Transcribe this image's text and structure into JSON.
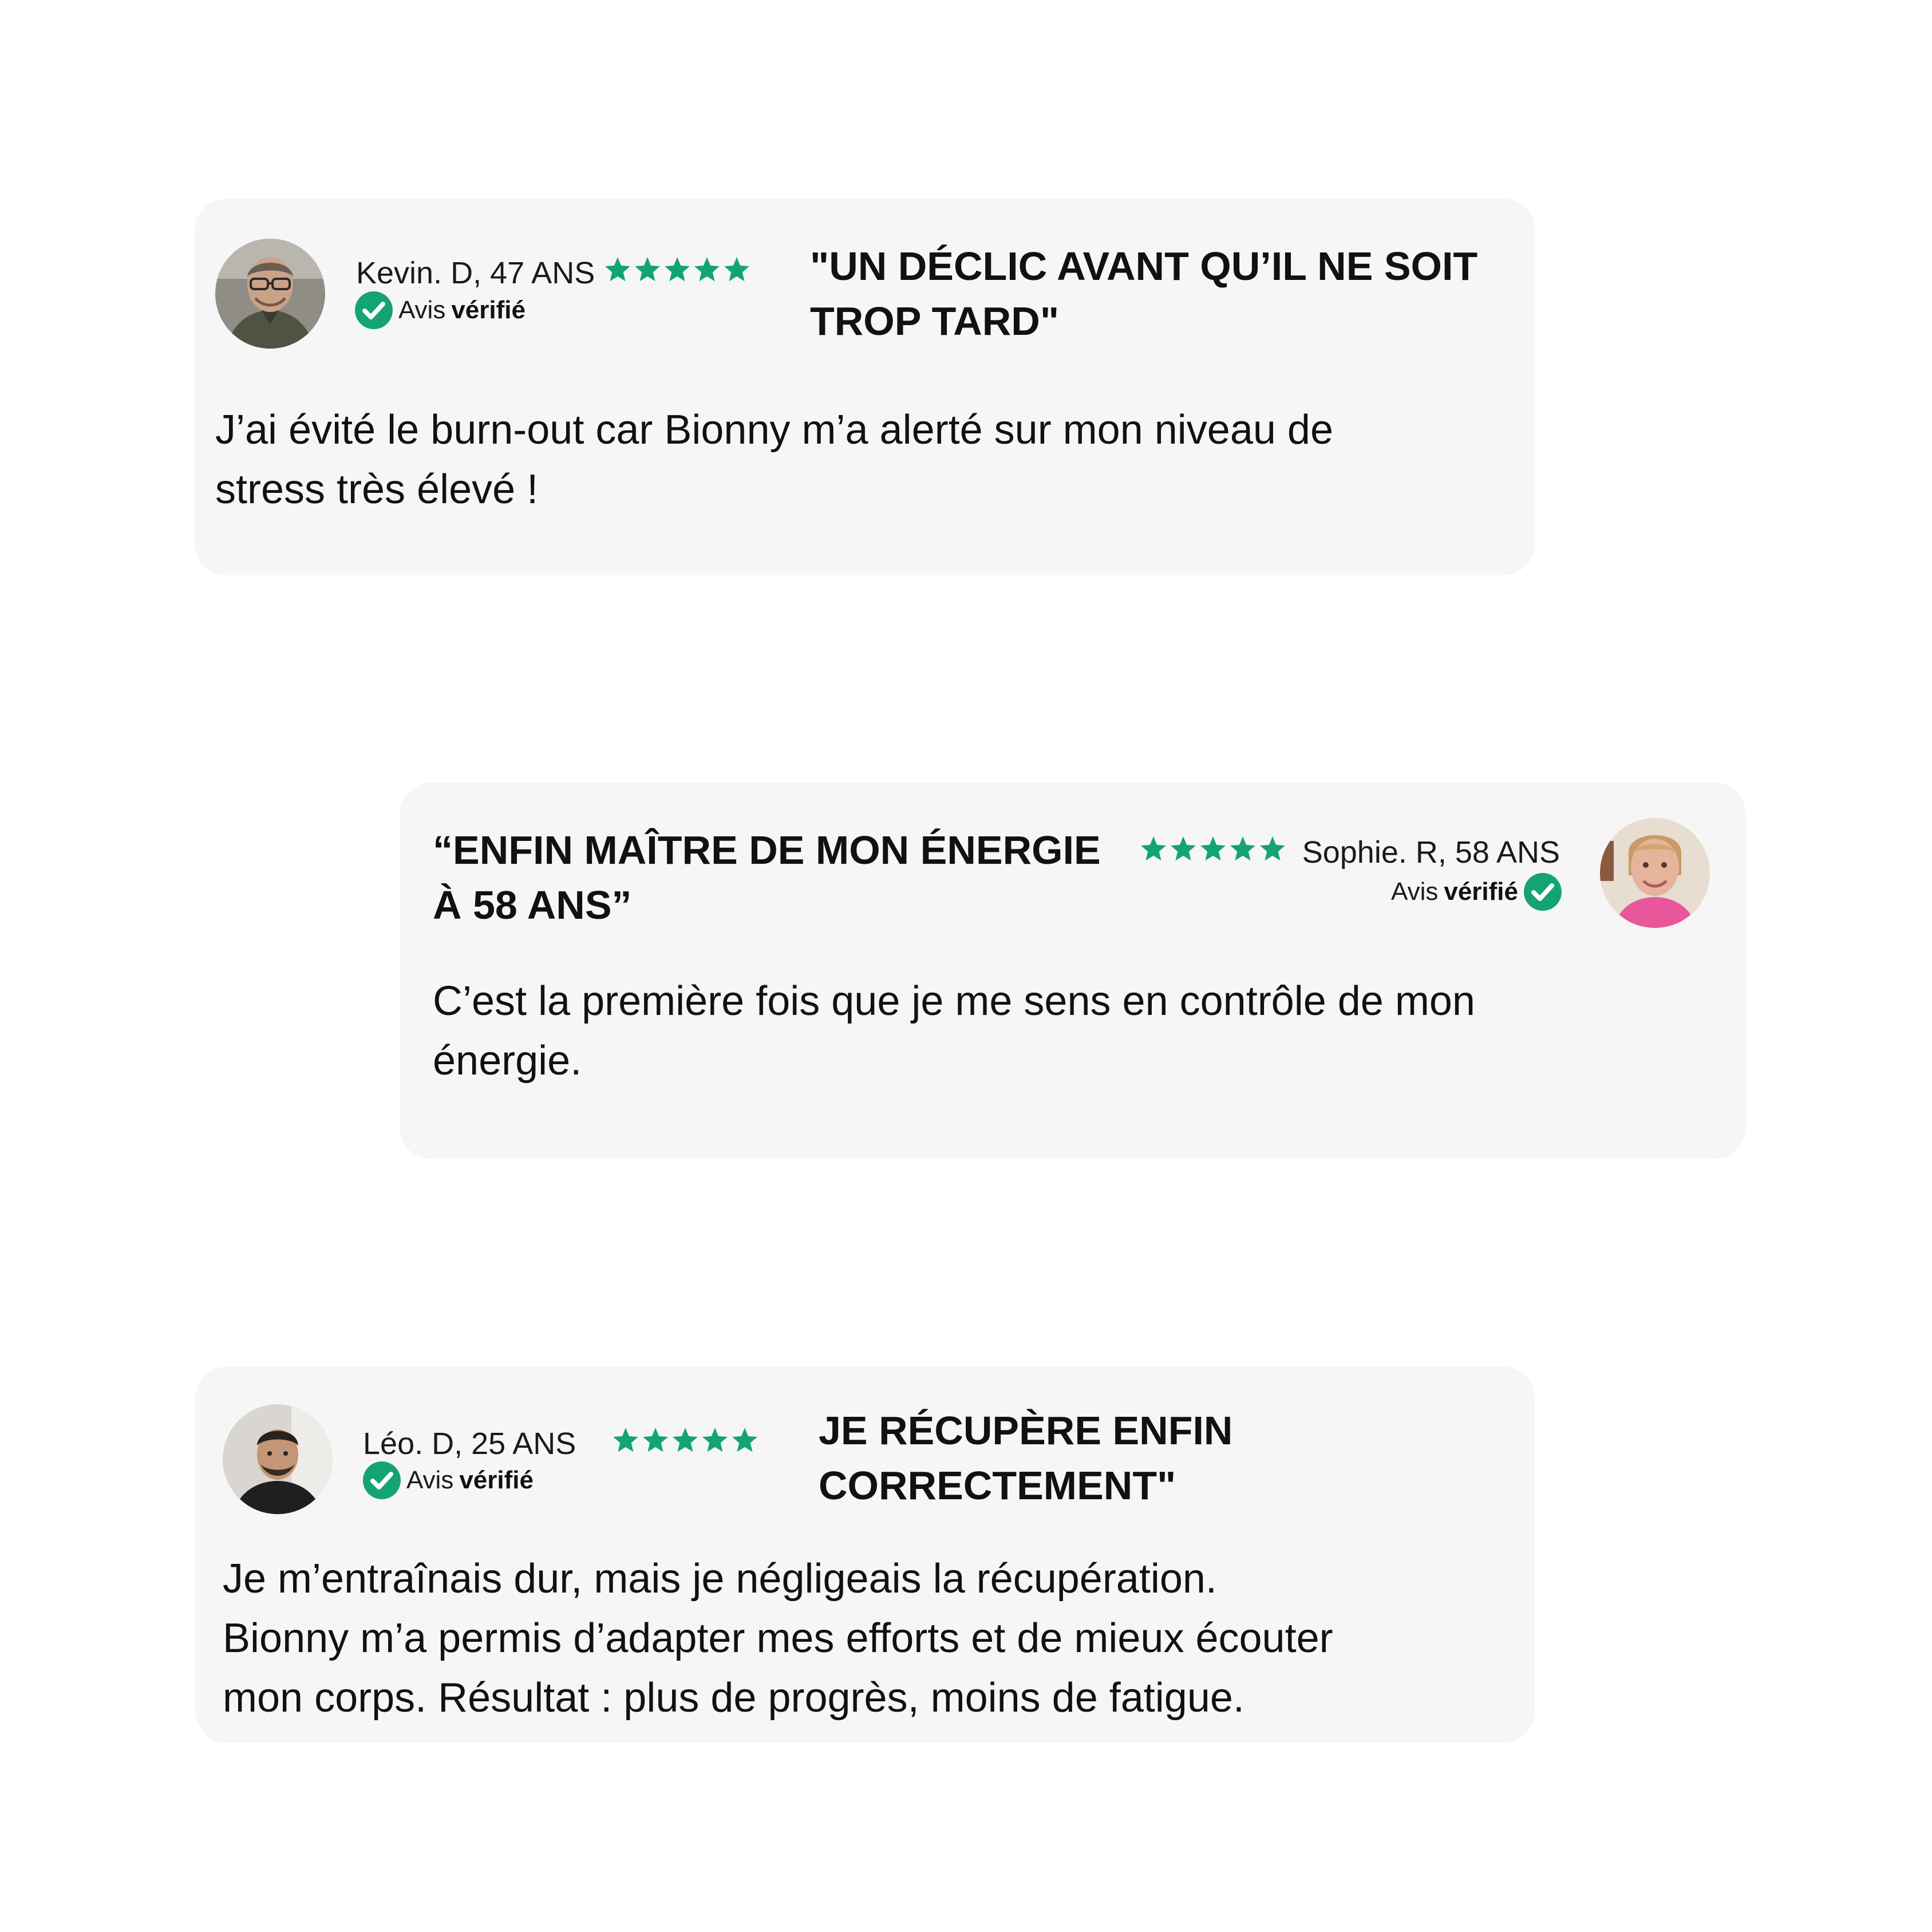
{
  "reviews": [
    {
      "author": "Kevin. D, 47 ANS",
      "rating": 5,
      "verified_prefix": "Avis",
      "verified_bold": "vérifié",
      "headline_lines": [
        "\"UN DÉCLIC AVANT QU’IL NE SOIT",
        "TROP TARD\""
      ],
      "body_lines": [
        "J’ai évité le burn-out car Bionny m’a alerté sur mon niveau de",
        "stress très élevé !"
      ]
    },
    {
      "author": "Sophie. R, 58 ANS",
      "rating": 5,
      "verified_prefix": "Avis",
      "verified_bold": "vérifié",
      "headline_lines": [
        "“ENFIN MAÎTRE DE MON ÉNERGIE",
        "À 58 ANS”"
      ],
      "body_lines": [
        "C’est la première fois que je me sens en contrôle de mon",
        "énergie."
      ]
    },
    {
      "author": "Léo. D, 25 ANS",
      "rating": 5,
      "verified_prefix": "Avis",
      "verified_bold": "vérifié",
      "headline_lines": [
        "JE RÉCUPÈRE ENFIN",
        "CORRECTEMENT\""
      ],
      "body_lines": [
        "Je m’entraînais dur, mais je négligeais la récupération.",
        "Bionny m’a permis d’adapter mes efforts et de mieux écouter",
        "mon corps. Résultat : plus de progrès, moins de fatigue."
      ]
    }
  ],
  "colors": {
    "card_background": "#f6f6f6",
    "star": "#14a374",
    "verified_badge": "#14a374",
    "text": "#111111"
  },
  "icons": {
    "star": "star-icon",
    "verified": "verified-check-icon"
  }
}
